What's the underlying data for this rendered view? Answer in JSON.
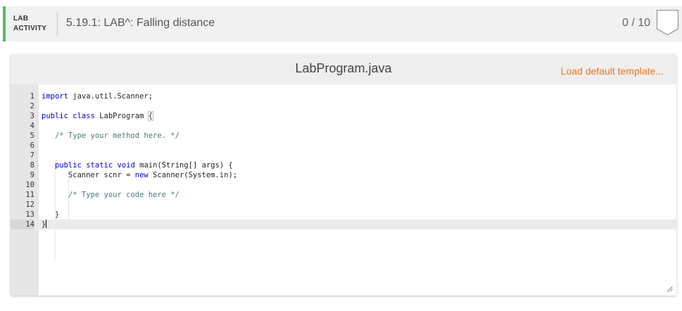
{
  "header": {
    "kind_line1": "LAB",
    "kind_line2": "ACTIVITY",
    "title": "5.19.1: LAB^: Falling distance",
    "score": "0 / 10",
    "accent_color": "#5cb85c"
  },
  "editor": {
    "file_name": "LabProgram.java",
    "load_template_label": "Load default template...",
    "link_color": "#e87722",
    "lines": [
      {
        "n": "1",
        "text": "import java.util.Scanner;"
      },
      {
        "n": "2",
        "text": ""
      },
      {
        "n": "3",
        "text": "public class LabProgram {"
      },
      {
        "n": "4",
        "text": ""
      },
      {
        "n": "5",
        "text": "   /* Type your method here. */"
      },
      {
        "n": "6",
        "text": ""
      },
      {
        "n": "7",
        "text": ""
      },
      {
        "n": "8",
        "text": "   public static void main(String[] args) {"
      },
      {
        "n": "9",
        "text": "      Scanner scnr = new Scanner(System.in);"
      },
      {
        "n": "10",
        "text": ""
      },
      {
        "n": "11",
        "text": "      /* Type your code here */"
      },
      {
        "n": "12",
        "text": ""
      },
      {
        "n": "13",
        "text": "   }"
      },
      {
        "n": "14",
        "text": "}"
      }
    ],
    "active_line": 14,
    "icons": {
      "score": "shield-badge-icon",
      "resize": "resize-grip-icon"
    }
  }
}
